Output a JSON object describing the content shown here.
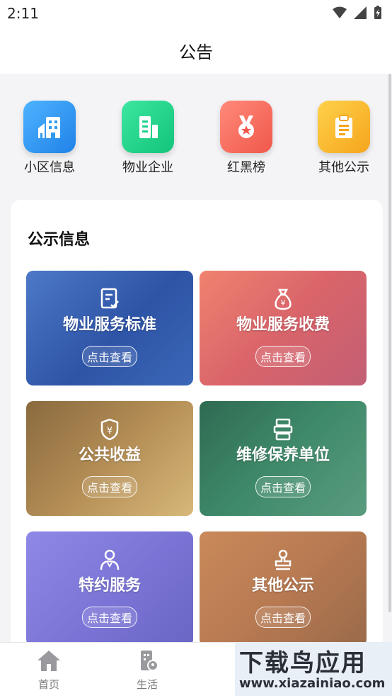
{
  "status_bar": {
    "time": "2:11"
  },
  "header": {
    "title": "公告"
  },
  "quick_links": [
    {
      "label": "小区信息",
      "icon": "building-icon",
      "color": "#2f9bf0"
    },
    {
      "label": "物业企业",
      "icon": "office-icon",
      "color": "#1fd08a"
    },
    {
      "label": "红黑榜",
      "icon": "medal-icon",
      "color": "#f7675a"
    },
    {
      "label": "其他公示",
      "icon": "clipboard-icon",
      "color": "#f7b82b"
    }
  ],
  "section": {
    "title": "公示信息",
    "tiles": [
      {
        "label": "物业服务标准",
        "button": "点击查看",
        "icon": "document-check-icon"
      },
      {
        "label": "物业服务收费",
        "button": "点击查看",
        "icon": "money-bag-icon"
      },
      {
        "label": "公共收益",
        "button": "点击查看",
        "icon": "yen-shield-icon"
      },
      {
        "label": "维修保养单位",
        "button": "点击查看",
        "icon": "printer-icon"
      },
      {
        "label": "特约服务",
        "button": "点击查看",
        "icon": "user-icon"
      },
      {
        "label": "其他公示",
        "button": "点击查看",
        "icon": "stamp-icon"
      }
    ]
  },
  "tab_bar": {
    "items": [
      {
        "label": "首页",
        "icon": "home-icon"
      },
      {
        "label": "生活",
        "icon": "life-icon"
      }
    ]
  },
  "watermark": {
    "main": "下载鸟应用",
    "sub": "www.xiazainiao.com"
  }
}
